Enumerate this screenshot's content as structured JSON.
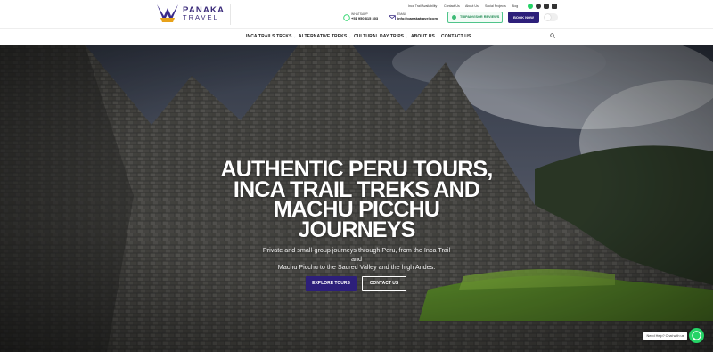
{
  "brand": {
    "name": "PANAKA",
    "sub": "TRAVEL"
  },
  "top_links": [
    "Inca Trail Availability",
    "Contact Us",
    "About Us",
    "Social Projects",
    "Blog"
  ],
  "social_icons": [
    "whatsapp-icon",
    "facebook-icon",
    "instagram-icon",
    "tiktok-icon"
  ],
  "contact": {
    "whatsapp_label": "WHATSAPP",
    "whatsapp_value": "+51 950 815 303",
    "email_label": "EMAIL",
    "email_value": "info@panakatravel.com"
  },
  "buttons": {
    "reviews": "TRIPADVISOR REVIEWS",
    "book_now": "BOOK NOW"
  },
  "nav": [
    {
      "label": "INCA TRAILS TREKS",
      "dropdown": true
    },
    {
      "label": "ALTERNATIVE TREKS",
      "dropdown": true
    },
    {
      "label": "CULTURAL DAY TRIPS",
      "dropdown": true
    },
    {
      "label": "ABOUT US",
      "dropdown": false
    },
    {
      "label": "CONTACT US",
      "dropdown": false
    }
  ],
  "hero": {
    "title_lines": [
      "AUTHENTIC PERU TOURS,",
      "INCA TRAIL TREKS AND",
      "MACHU PICCHU",
      "JOURNEYS"
    ],
    "subtitle_lines": [
      "Private and small-group journeys through Peru, from the Inca Trail and",
      "Machu Picchu to the Sacred Valley and the high Andes."
    ],
    "cta_primary": "EXPLORE TOURS",
    "cta_secondary": "CONTACT US"
  },
  "chat": {
    "help": "Need Help? Chat with us"
  },
  "colors": {
    "brand_purple": "#2d1f7a",
    "accent_green": "#25d366",
    "logo_gold": "#e8a21a"
  }
}
